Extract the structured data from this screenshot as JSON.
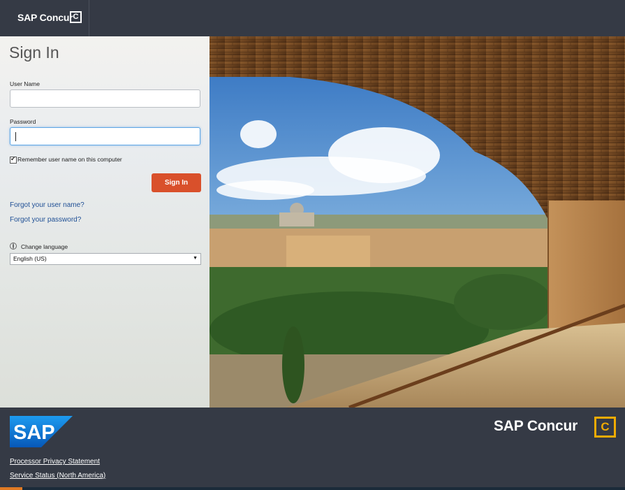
{
  "header": {
    "brand": "SAP Concur",
    "brand_mark": "C"
  },
  "form": {
    "title": "Sign In",
    "username_label": "User Name",
    "username_value": "",
    "password_label": "Password",
    "password_value": "",
    "remember_label": "Remember user name on this computer",
    "remember_checked": true,
    "signin_label": "Sign In",
    "forgot_username": "Forgot your user name?",
    "forgot_password": "Forgot your password?",
    "change_language": "Change language",
    "language_selected": "English (US)"
  },
  "footer": {
    "sap_logo_text": "SAP",
    "brand": "SAP Concur",
    "brand_mark": "C",
    "links": [
      "Processor Privacy Statement",
      "Service Status (North America)"
    ]
  },
  "colors": {
    "topbar": "#353a45",
    "signin_button": "#d9502b",
    "link": "#1f4f95",
    "concur_yellow": "#f0ab00",
    "sap_blue": "#0a6ed1"
  }
}
